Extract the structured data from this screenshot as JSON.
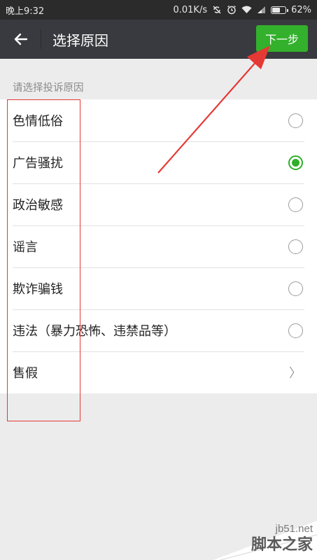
{
  "status_bar": {
    "time": "晚上9:32",
    "network_speed": "0.01K/s",
    "battery_percent": "62%",
    "battery_level": 0.62,
    "icons": [
      "sync-off-icon",
      "alarm-icon",
      "wifi-icon",
      "signal-icon",
      "battery-icon"
    ]
  },
  "app_bar": {
    "back_icon": "back-arrow-icon",
    "title": "选择原因",
    "next_label": "下一步"
  },
  "section_label": "请选择投诉原因",
  "reasons": [
    {
      "label": "色情低俗",
      "control": "radio",
      "selected": false
    },
    {
      "label": "广告骚扰",
      "control": "radio",
      "selected": true
    },
    {
      "label": "政治敏感",
      "control": "radio",
      "selected": false
    },
    {
      "label": "谣言",
      "control": "radio",
      "selected": false
    },
    {
      "label": "欺诈骗钱",
      "control": "radio",
      "selected": false
    },
    {
      "label": "违法（暴力恐怖、违禁品等）",
      "control": "radio",
      "selected": false
    },
    {
      "label": "售假",
      "control": "chevron",
      "chevron_glyph": "〉"
    }
  ],
  "colors": {
    "accent_green": "#33b12c",
    "app_bar": "#393a3f",
    "annotation_red": "#e53935"
  },
  "watermark": {
    "url": "jb51.net",
    "name": "脚本之家"
  }
}
